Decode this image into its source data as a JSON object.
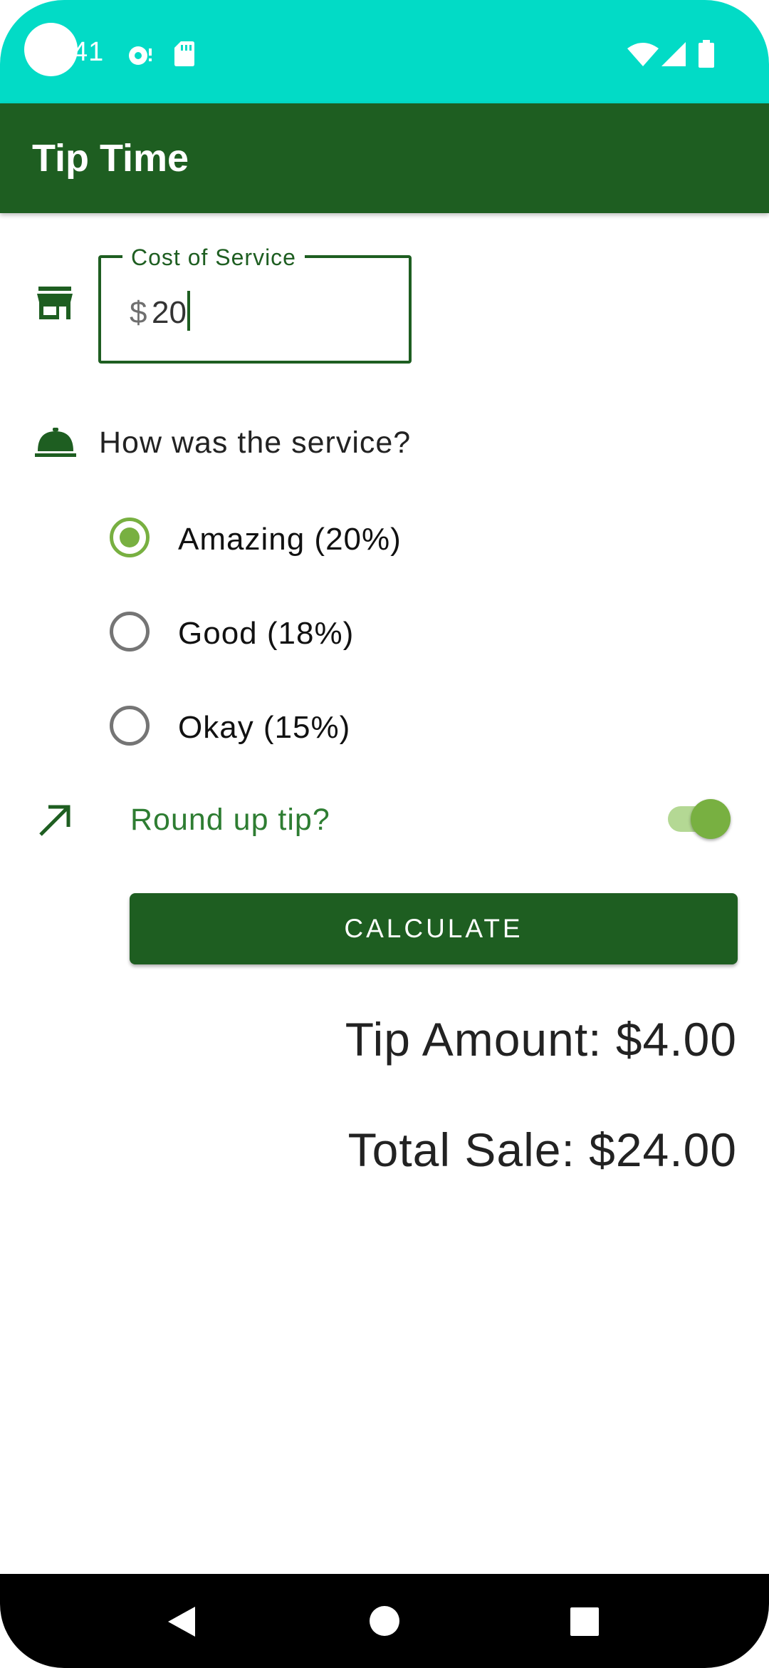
{
  "status_bar": {
    "time": "41",
    "background": "#02dbc6",
    "icons": [
      "settings-notification-icon",
      "sd-card-icon",
      "wifi-icon",
      "cellular-signal-icon",
      "battery-icon"
    ]
  },
  "app_bar": {
    "title": "Tip Time",
    "background": "#1e5e21"
  },
  "cost_field": {
    "label": "Cost of Service",
    "prefix": "$",
    "value": "20",
    "icon": "storefront-icon"
  },
  "service_question": {
    "label": "How was the service?",
    "icon": "room-service-bell-icon"
  },
  "tip_options": [
    {
      "label": "Amazing (20%)",
      "selected": true
    },
    {
      "label": "Good (18%)",
      "selected": false
    },
    {
      "label": "Okay (15%)",
      "selected": false
    }
  ],
  "round_up": {
    "label": "Round up tip?",
    "enabled": true,
    "icon": "trending-up-arrow-icon"
  },
  "calculate_button": {
    "label": "CALCULATE"
  },
  "results": {
    "tip_amount": "Tip Amount: $4.00",
    "total_sale": "Total Sale: $24.00"
  },
  "accent_colors": {
    "primary": "#1e5e21",
    "secondary": "#78b041"
  }
}
